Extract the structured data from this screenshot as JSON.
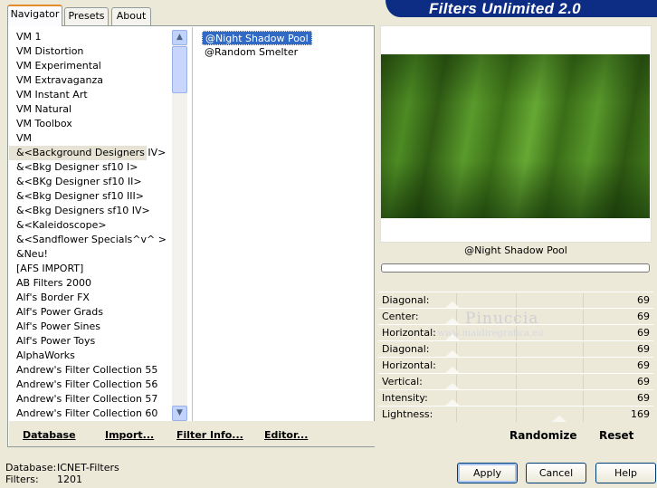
{
  "window": {
    "title": "Filters Unlimited 2.0"
  },
  "tabs": [
    {
      "label": "Navigator",
      "active": true
    },
    {
      "label": "Presets",
      "active": false
    },
    {
      "label": "About",
      "active": false
    }
  ],
  "categories": [
    "VM 1",
    "VM Distortion",
    "VM Experimental",
    "VM Extravaganza",
    "VM Instant Art",
    "VM Natural",
    "VM Toolbox",
    "VM",
    "&<Background Designers IV>",
    "&<Bkg Designer sf10 I>",
    "&<BKg Designer sf10 II>",
    "&<Bkg Designer sf10 III>",
    "&<Bkg Designers sf10 IV>",
    "&<Kaleidoscope>",
    "&<Sandflower Specials^v^ >",
    "&Neu!",
    "[AFS IMPORT]",
    "AB Filters 2000",
    "Alf's Border FX",
    "Alf's Power Grads",
    "Alf's Power Sines",
    "Alf's Power Toys",
    "AlphaWorks",
    "Andrew's Filter Collection 55",
    "Andrew's Filter Collection 56",
    "Andrew's Filter Collection 57",
    "Andrew's Filter Collection 60"
  ],
  "selected_category_index": 8,
  "filters": [
    {
      "label": "@Night Shadow Pool",
      "selected": true
    },
    {
      "label": "@Random Smelter",
      "selected": false
    }
  ],
  "bottom_links": {
    "database": "Database",
    "import": "Import...",
    "filter_info": "Filter Info...",
    "editor": "Editor..."
  },
  "preview": {
    "filter_name": "@Night Shadow Pool",
    "progress": 0
  },
  "sliders": [
    {
      "label": "Diagonal:",
      "value": "69"
    },
    {
      "label": "Center:",
      "value": "69"
    },
    {
      "label": "Horizontal:",
      "value": "69"
    },
    {
      "label": "Diagonal:",
      "value": "69"
    },
    {
      "label": "Horizontal:",
      "value": "69"
    },
    {
      "label": "Vertical:",
      "value": "69"
    },
    {
      "label": "Intensity:",
      "value": "69"
    },
    {
      "label": "Lightness:",
      "value": "169"
    }
  ],
  "watermark": {
    "name": "Pinuccia",
    "url": "www.maidiregrafica.eu"
  },
  "right_actions": {
    "randomize": "Randomize",
    "reset": "Reset"
  },
  "status": {
    "database_label": "Database:",
    "database_value": "ICNET-Filters",
    "filters_label": "Filters:",
    "filters_value": "1201"
  },
  "buttons": {
    "apply": "Apply",
    "cancel": "Cancel",
    "help": "Help"
  },
  "colors": {
    "banner": "#0c2d83",
    "selection": "#316ac5",
    "active_tab_accent": "#e68b2c"
  }
}
